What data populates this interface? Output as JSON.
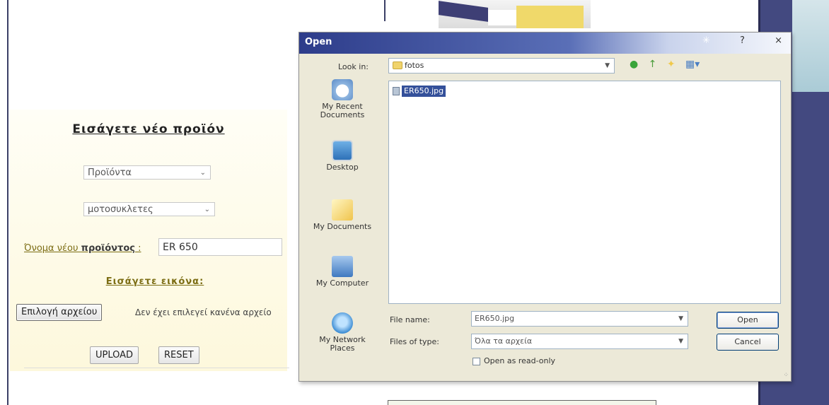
{
  "form": {
    "title": "Εισάγετε νέο προϊόν",
    "category_select": "Προϊόντα",
    "subcategory_select": "μοτοσυκλετες",
    "name_label_prefix": "Όνομα νέου ",
    "name_label_bold": "προϊόντος",
    "name_label_suffix": " :",
    "name_value": "ER 650",
    "image_label": "Εισάγετε εικόνα:",
    "choose_file_label": "Επιλογή αρχείου",
    "file_status": "Δεν έχει επιλεγεί κανένα αρχείο",
    "upload_label": "UPLOAD",
    "reset_label": "RESET"
  },
  "dialog": {
    "title": "Open",
    "help_label": "?",
    "close_label": "×",
    "look_in_label": "Look in:",
    "look_in_value": "fotos",
    "places": [
      {
        "label": "My Recent Documents"
      },
      {
        "label": "Desktop"
      },
      {
        "label": "My Documents"
      },
      {
        "label": "My Computer"
      },
      {
        "label": "My Network Places"
      }
    ],
    "files": [
      {
        "name": "ER650.jpg",
        "selected": true
      }
    ],
    "file_name_label": "File name:",
    "file_name_value": "ER650.jpg",
    "files_of_type_label": "Files of type:",
    "files_of_type_value": "Όλα τα αρχεία",
    "open_button": "Open",
    "cancel_button": "Cancel",
    "read_only_label": "Open as read-only"
  },
  "colors": {
    "titlebar": "#2d3c8a",
    "selection": "#34509a",
    "page_band": "#434980"
  }
}
